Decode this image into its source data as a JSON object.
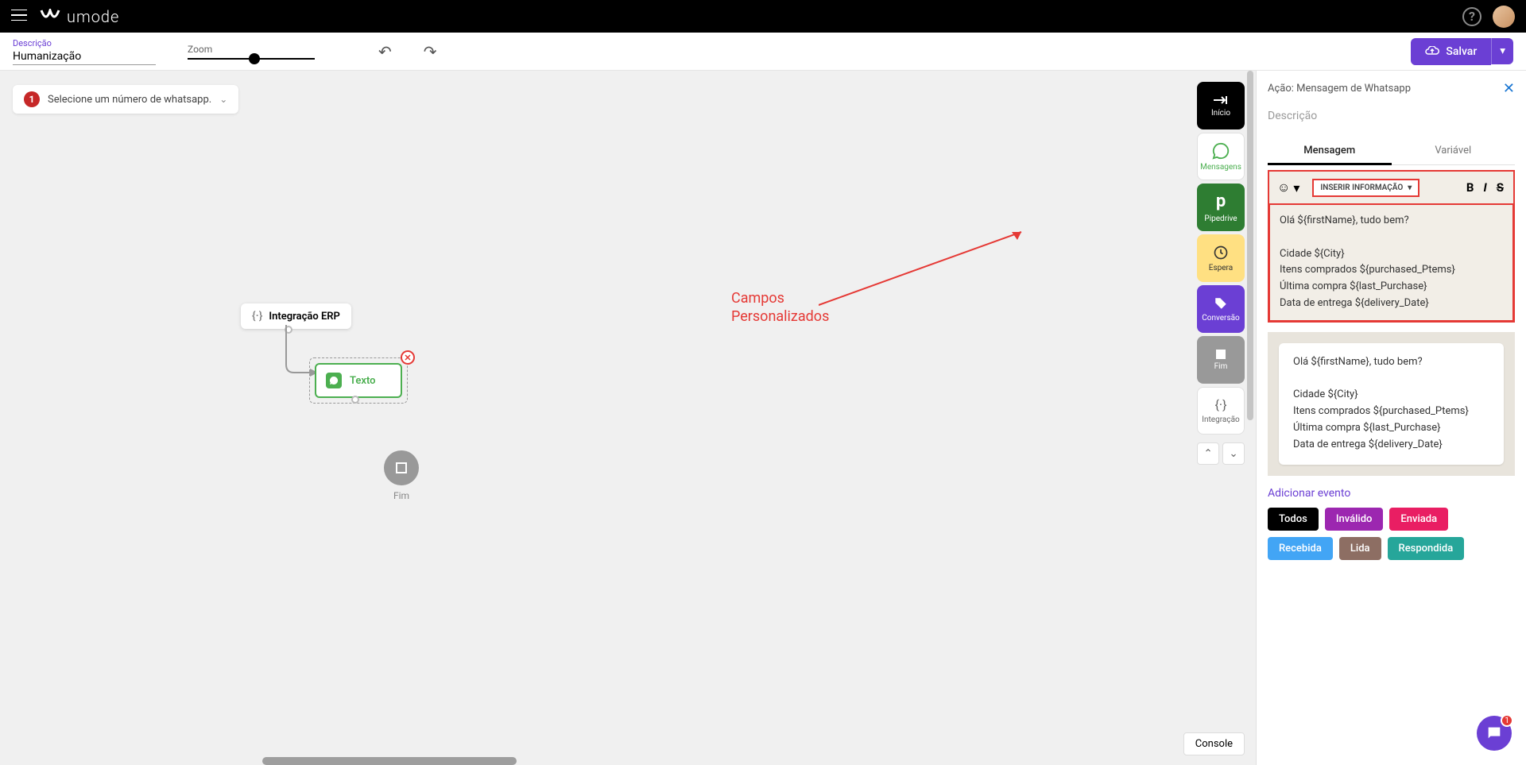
{
  "header": {
    "brand": "umode",
    "help": "?"
  },
  "toolbar": {
    "desc_label": "Descrição",
    "desc_value": "Humanização",
    "zoom_label": "Zoom",
    "save_label": "Salvar"
  },
  "alert": {
    "number": "1",
    "text": "Selecione um número de whatsapp."
  },
  "canvas": {
    "erp_label": "Integração ERP",
    "texto_label": "Texto",
    "fim_label": "Fim",
    "annotation_line1": "Campos",
    "annotation_line2": "Personalizados"
  },
  "palette": {
    "inicio": "Início",
    "mensagens": "Mensagens",
    "pipedrive": "Pipedrive",
    "espera": "Espera",
    "conversao": "Conversão",
    "fim": "Fim",
    "integracao": "Integração"
  },
  "console_label": "Console",
  "side": {
    "title": "Ação: Mensagem de Whatsapp",
    "desc": "Descrição",
    "tab_msg": "Mensagem",
    "tab_var": "Variável",
    "insert_info": "INSERIR INFORMAÇÃO",
    "editor_lines": [
      "Olá ${firstName}, tudo bem?",
      "",
      "Cidade ${City}",
      "Itens comprados ${purchased_Ptems}",
      "Última compra ${last_Purchase}",
      "Data de entrega ${delivery_Date}"
    ],
    "preview_lines": [
      "Olá ${firstName}, tudo bem?",
      "",
      "Cidade ${City}",
      "Itens comprados ${purchased_Ptems}",
      "Última compra ${last_Purchase}",
      "Data de entrega ${delivery_Date}"
    ],
    "add_event": "Adicionar evento",
    "tags": {
      "todos": "Todos",
      "invalido": "Inválido",
      "enviada": "Enviada",
      "recebida": "Recebida",
      "lida": "Lida",
      "respondida": "Respondida"
    }
  },
  "chat_badge": "1"
}
